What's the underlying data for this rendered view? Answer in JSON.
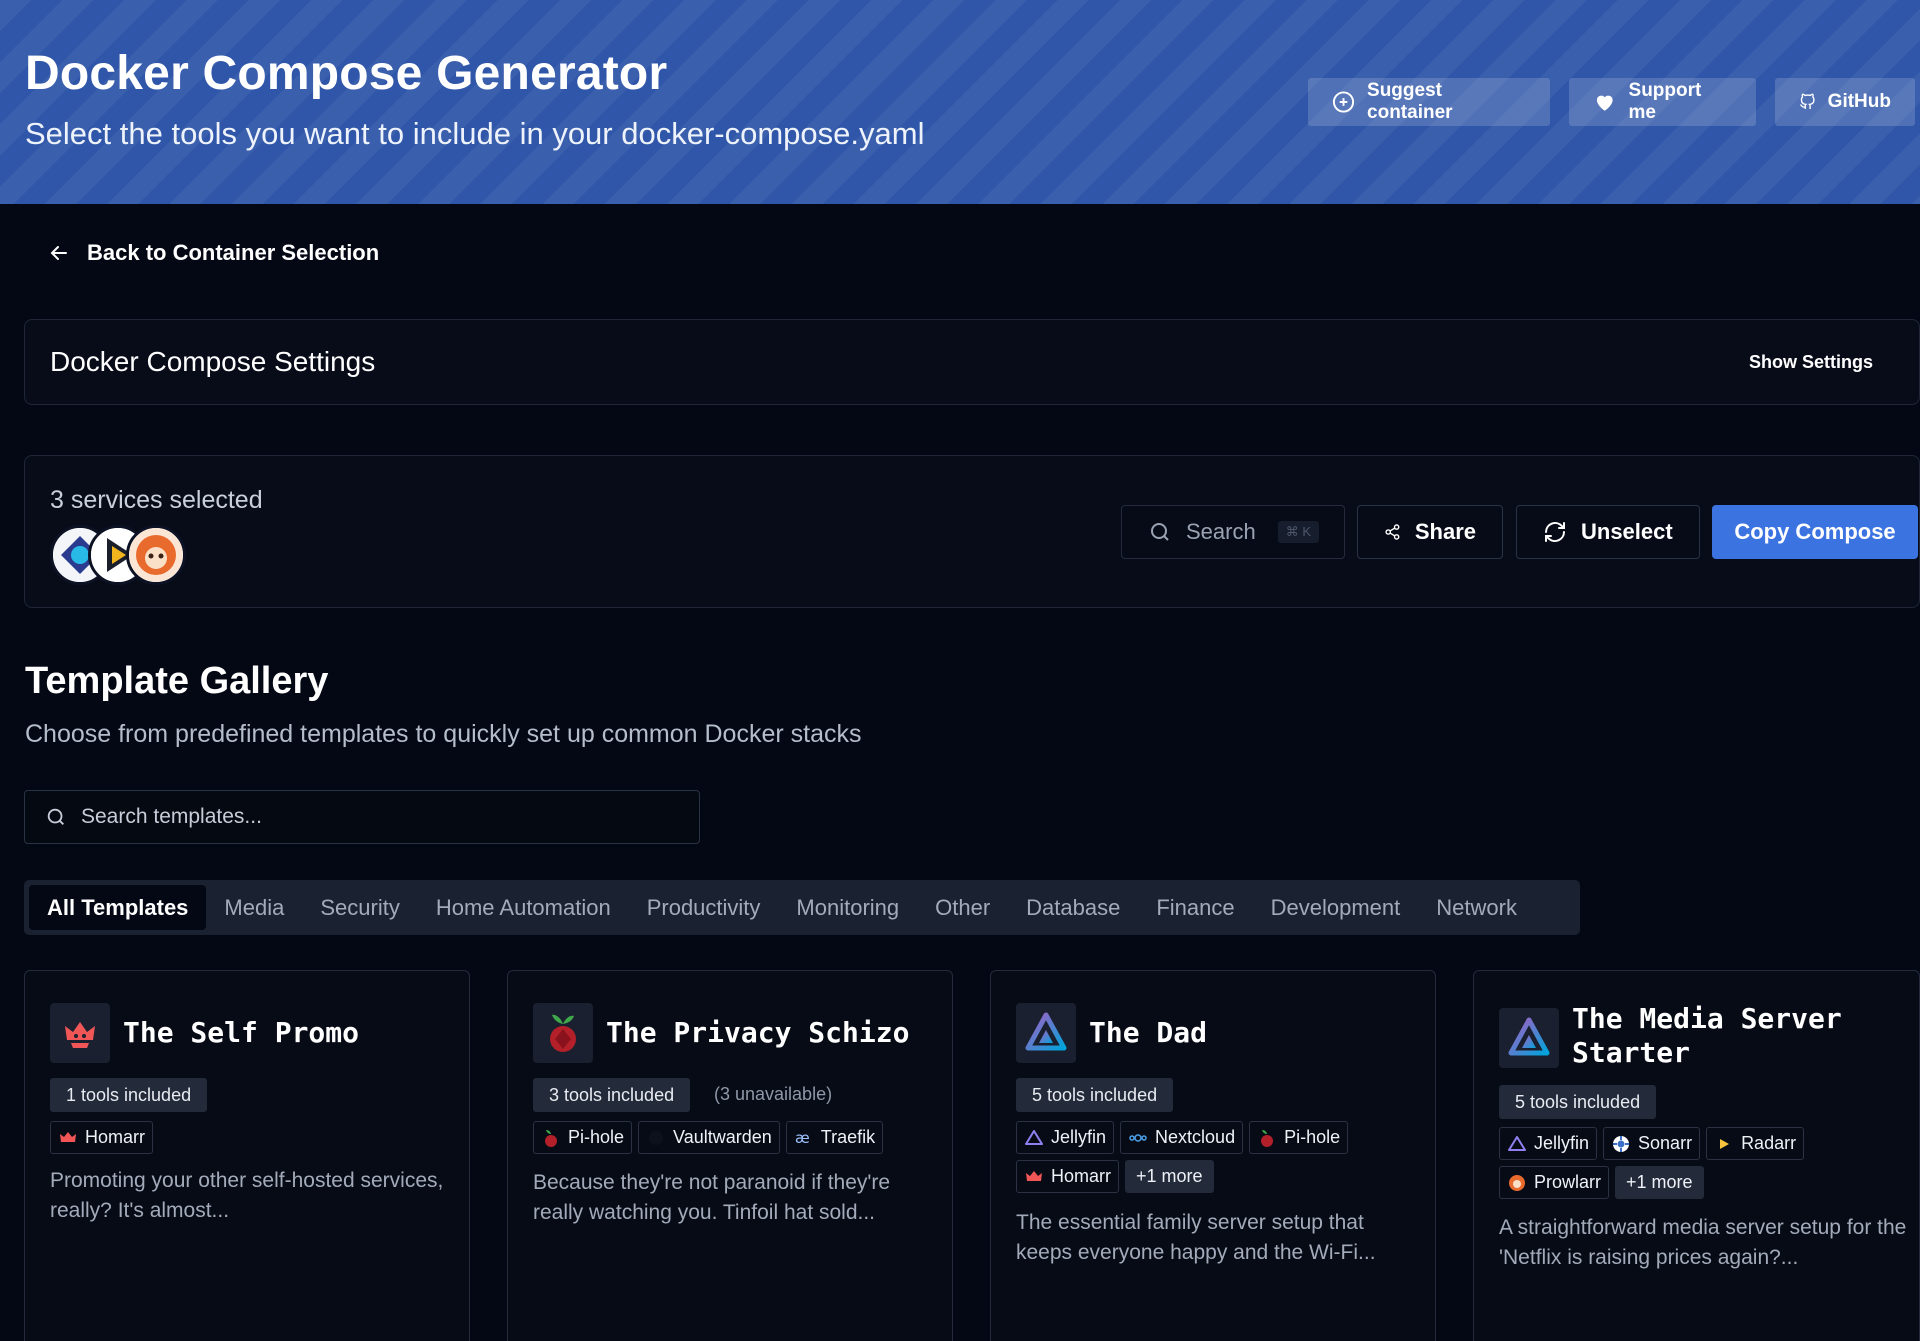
{
  "header": {
    "title": "Docker Compose Generator",
    "subtitle": "Select the tools you want to include in your docker-compose.yaml",
    "buttons": {
      "suggest": "Suggest container",
      "support": "Support me",
      "github": "GitHub"
    }
  },
  "nav": {
    "back_label": "Back to Container Selection"
  },
  "settings": {
    "title": "Docker Compose Settings",
    "toggle_label": "Show Settings"
  },
  "selection": {
    "count_text": "3 services selected",
    "avatars": [
      "jellyfin-logo",
      "infuse-logo",
      "prowlarr-logo"
    ],
    "search_label": "Search",
    "search_shortcut": "⌘ K",
    "share_label": "Share",
    "unselect_label": "Unselect",
    "copy_label": "Copy Compose"
  },
  "gallery": {
    "title": "Template Gallery",
    "subtitle": "Choose from predefined templates to quickly set up common Docker stacks",
    "search_placeholder": "Search templates...",
    "tabs": [
      "All Templates",
      "Media",
      "Security",
      "Home Automation",
      "Productivity",
      "Monitoring",
      "Other",
      "Database",
      "Finance",
      "Development",
      "Network"
    ],
    "active_tab": "All Templates"
  },
  "cards": [
    {
      "title": "The Self Promo",
      "icon": "homarr-icon",
      "tools_count": "1 tools included",
      "unavailable": "",
      "tools": [
        "Homarr"
      ],
      "more": "",
      "description": "Promoting your other self-hosted services, really? It's almost..."
    },
    {
      "title": "The Privacy Schizo",
      "icon": "pihole-icon",
      "tools_count": "3 tools included",
      "unavailable": "(3 unavailable)",
      "tools": [
        "Pi-hole",
        "Vaultwarden",
        "Traefik"
      ],
      "more": "",
      "description": "Because they're not paranoid if they're really watching you. Tinfoil hat sold..."
    },
    {
      "title": "The Dad",
      "icon": "jellyfin-icon",
      "tools_count": "5 tools included",
      "unavailable": "",
      "tools": [
        "Jellyfin",
        "Nextcloud",
        "Pi-hole",
        "Homarr"
      ],
      "more": "+1 more",
      "description": "The essential family server setup that keeps everyone happy and the Wi-Fi..."
    },
    {
      "title_line1": "The Media Server",
      "title_line2": "Starter",
      "icon": "jellyfin-icon",
      "tools_count": "5 tools included",
      "unavailable": "",
      "tools": [
        "Jellyfin",
        "Sonarr",
        "Radarr",
        "Prowlarr"
      ],
      "more": "+1 more",
      "description": "A straightforward media server setup for the 'Netflix is raising prices again?..."
    }
  ],
  "colors": {
    "header_bg": "#2f56a8",
    "page_bg": "#040814",
    "accent": "#3b73e0"
  }
}
